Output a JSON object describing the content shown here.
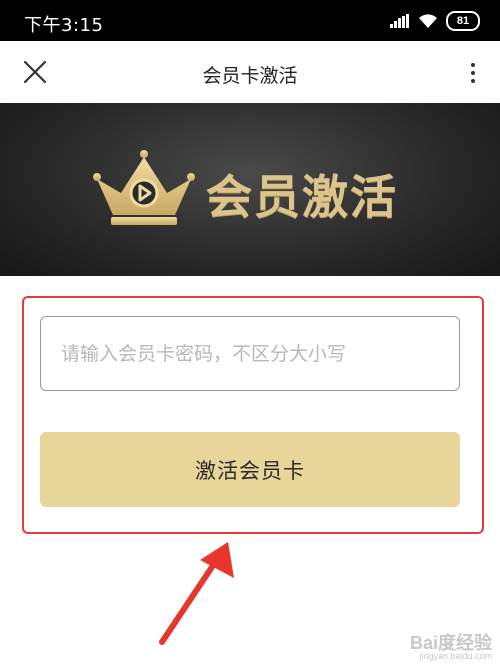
{
  "status_bar": {
    "time": "下午3:15",
    "battery": "81",
    "icons": [
      "signal-icon",
      "wifi-icon",
      "battery-icon"
    ]
  },
  "nav": {
    "title": "会员卡激活",
    "icons": [
      "close-icon",
      "more-vert-icon"
    ]
  },
  "banner": {
    "title": "会员激活",
    "icon": "crown-play-icon"
  },
  "form": {
    "password_placeholder": "请输入会员卡密码，不区分大小写",
    "password_value": "",
    "submit_label": "激活会员卡"
  },
  "annotation": {
    "highlight_color": "#e23c3c",
    "arrow_icon": "red-arrow-icon"
  },
  "watermark": {
    "text": "Bai度经验",
    "subtext": "jingyan.baidu.com"
  },
  "colors": {
    "accent_gold": "#e8d59a",
    "banner_gold": "#dcc58c"
  }
}
